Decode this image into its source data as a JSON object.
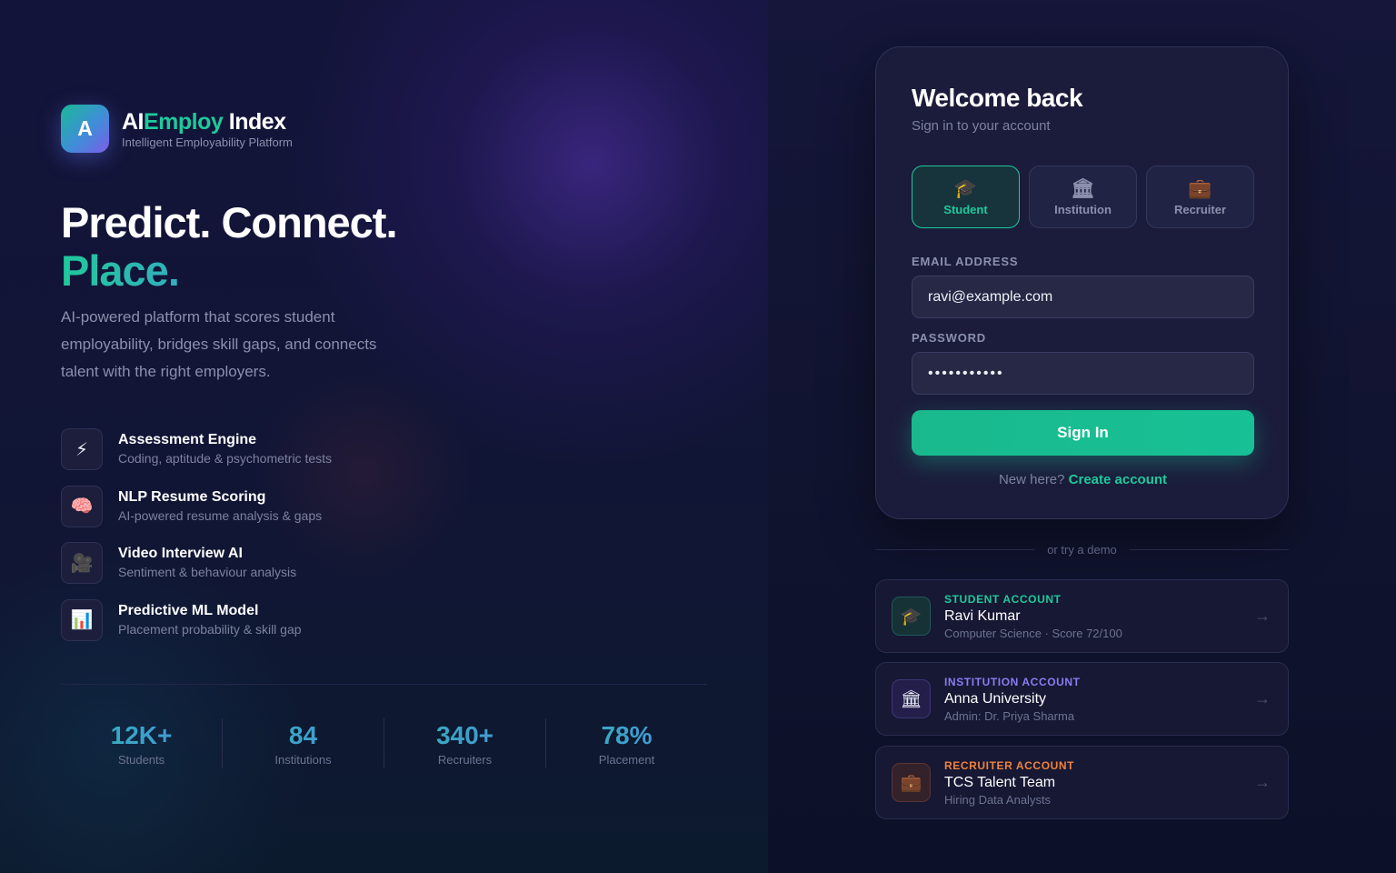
{
  "brand": {
    "logo_letter": "A",
    "name_part1": "AI",
    "name_part2": "Employ",
    "name_part3": " Index",
    "tagline": "Intelligent Employability Platform"
  },
  "hero": {
    "line1": "Predict. Connect.",
    "line2": "Place.",
    "description": "AI-powered platform that scores student employability, bridges skill gaps, and connects talent with the right employers."
  },
  "features": [
    {
      "icon": "lightning-icon",
      "glyph": "⚡",
      "title": "Assessment Engine",
      "subtitle": "Coding, aptitude & psychometric tests"
    },
    {
      "icon": "brain-icon",
      "glyph": "🧠",
      "title": "NLP Resume Scoring",
      "subtitle": "AI-powered resume analysis & gaps"
    },
    {
      "icon": "video-camera-icon",
      "glyph": "🎥",
      "title": "Video Interview AI",
      "subtitle": "Sentiment & behaviour analysis"
    },
    {
      "icon": "bar-chart-icon",
      "glyph": "📊",
      "title": "Predictive ML Model",
      "subtitle": "Placement probability & skill gap"
    }
  ],
  "stats": [
    {
      "value": "12K+",
      "label": "Students"
    },
    {
      "value": "84",
      "label": "Institutions"
    },
    {
      "value": "340+",
      "label": "Recruiters"
    },
    {
      "value": "78%",
      "label": "Placement"
    }
  ],
  "login": {
    "title": "Welcome back",
    "subtitle": "Sign in to your account",
    "roles": [
      {
        "icon": "graduation-cap-icon",
        "glyph": "🎓",
        "label": "Student",
        "active": true
      },
      {
        "icon": "institution-icon",
        "glyph": "🏛",
        "label": "Institution",
        "active": false
      },
      {
        "icon": "briefcase-icon",
        "glyph": "💼",
        "label": "Recruiter",
        "active": false
      }
    ],
    "email_label": "EMAIL ADDRESS",
    "email_value": "ravi@example.com",
    "password_label": "PASSWORD",
    "password_value": "•••••••••••",
    "signin_label": "Sign In",
    "new_here": "New here?",
    "create_account": "Create account"
  },
  "demo": {
    "divider_text": "or try a demo",
    "accounts": [
      {
        "kind": "STUDENT ACCOUNT",
        "kind_color": "#1fc99b",
        "icon": "graduation-cap-icon",
        "glyph": "🎓",
        "name": "Ravi Kumar",
        "meta": "Computer Science · Score 72/100",
        "arrow": "→"
      },
      {
        "kind": "INSTITUTION ACCOUNT",
        "kind_color": "#8a7cf0",
        "icon": "institution-icon",
        "glyph": "🏛",
        "name": "Anna University",
        "meta": "Admin: Dr. Priya Sharma",
        "arrow": "→"
      },
      {
        "kind": "RECRUITER ACCOUNT",
        "kind_color": "#f0823a",
        "icon": "briefcase-icon",
        "glyph": "💼",
        "name": "TCS Talent Team",
        "meta": "Hiring Data Analysts",
        "arrow": "→"
      }
    ]
  },
  "colors": {
    "accent": "#1fc99b",
    "institution": "#8a7cf0",
    "recruiter": "#f0823a",
    "background": "#0d1024"
  }
}
